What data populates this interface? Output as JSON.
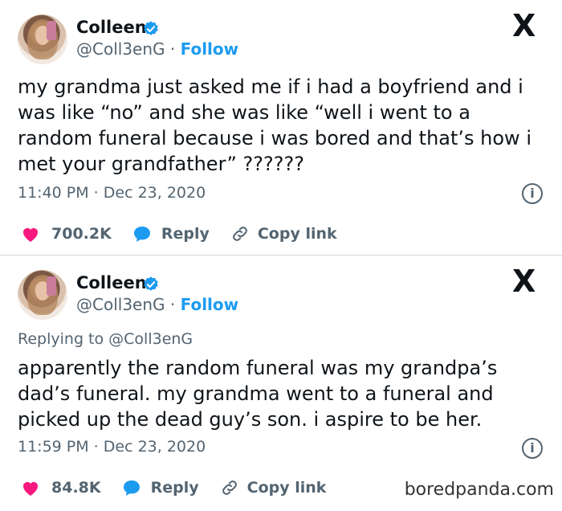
{
  "tweet1": {
    "name": "Colleen",
    "handle": "@Coll3enG",
    "dot": "·",
    "follow": "Follow",
    "text": "my grandma just asked me if i had a boyfriend and i was like “no” and she was like “well i went to a random funeral because i was bored and that’s how i met your grandfather” ??????",
    "time": "11:40 PM · Dec 23, 2020",
    "likes": "700.2K",
    "reply": "Reply",
    "copy": "Copy link"
  },
  "tweet2": {
    "name": "Colleen",
    "handle": "@Coll3enG",
    "dot": "·",
    "follow": "Follow",
    "replying": "Replying to @Coll3enG",
    "text": "apparently the random funeral was my grandpa’s dad’s funeral. my grandma went to a funeral and picked up the dead guy’s son. i aspire to be her.",
    "time": "11:59 PM · Dec 23, 2020",
    "likes": "84.8K",
    "reply": "Reply",
    "copy": "Copy link"
  },
  "xlogo": "X",
  "info_glyph": "i",
  "watermark": "boredpanda.com",
  "colors": {
    "blue": "#1d9bf0",
    "heart": "#f91880",
    "muted": "#536471",
    "divider": "#cfd9de"
  },
  "icons": [
    "verified-badge-icon",
    "x-logo-icon",
    "heart-icon",
    "reply-bubble-icon",
    "link-icon",
    "info-icon"
  ]
}
